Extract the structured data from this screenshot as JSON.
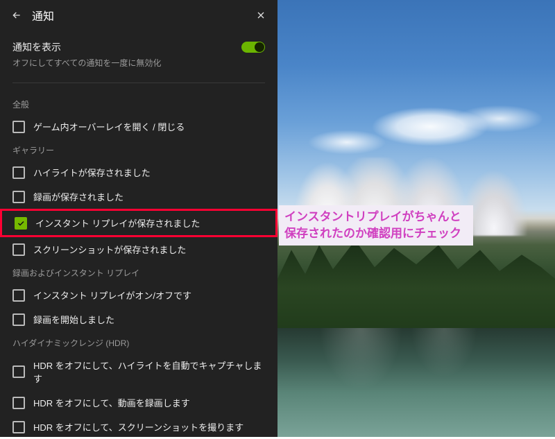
{
  "header": {
    "title": "通知"
  },
  "toggle": {
    "title": "通知を表示",
    "desc": "オフにしてすべての通知を一度に無効化",
    "on": true
  },
  "sections": [
    {
      "header": "全般",
      "items": [
        {
          "label": "ゲーム内オーバーレイを開く / 閉じる",
          "checked": false
        }
      ]
    },
    {
      "header": "ギャラリー",
      "items": [
        {
          "label": "ハイライトが保存されました",
          "checked": false
        },
        {
          "label": "録画が保存されました",
          "checked": false
        },
        {
          "label": "インスタント リプレイが保存されました",
          "checked": true,
          "highlight": true
        },
        {
          "label": "スクリーンショットが保存されました",
          "checked": false
        }
      ]
    },
    {
      "header": "録画およびインスタント リプレイ",
      "items": [
        {
          "label": "インスタント リプレイがオン/オフです",
          "checked": false
        },
        {
          "label": "録画を開始しました",
          "checked": false
        }
      ]
    },
    {
      "header": "ハイダイナミックレンジ (HDR)",
      "items": [
        {
          "label": "HDR をオフにして、ハイライトを自動でキャプチャします",
          "checked": false
        },
        {
          "label": "HDR をオフにして、動画を録画します",
          "checked": false
        },
        {
          "label": "HDR をオフにして、スクリーンショットを撮ります",
          "checked": false
        }
      ]
    }
  ],
  "annotation": "インスタントリプレイがちゃんと保存されたのか確認用にチェック",
  "colors": {
    "accent": "#76b900",
    "highlight": "#ff0033"
  }
}
